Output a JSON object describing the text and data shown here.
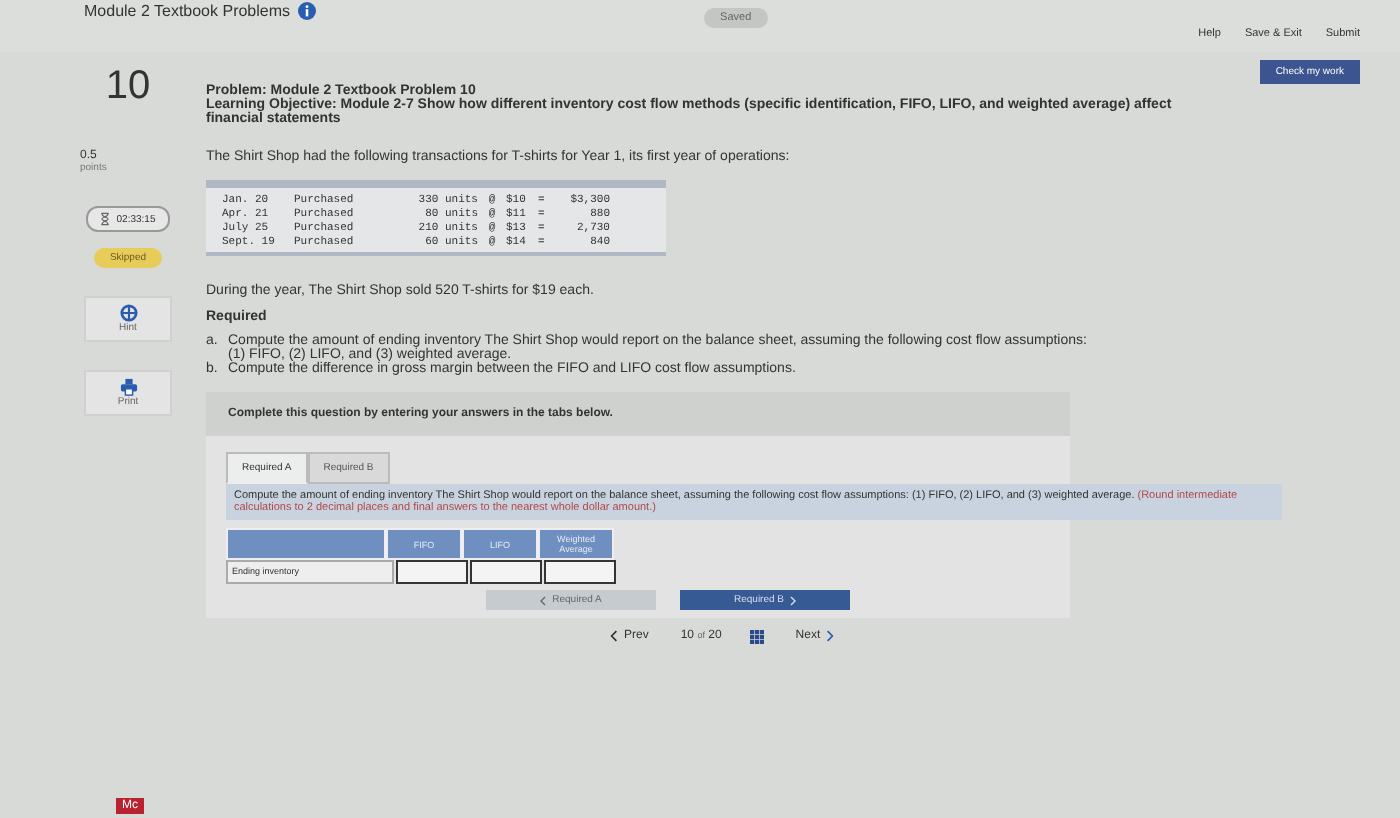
{
  "header": {
    "title": "Module 2 Textbook Problems",
    "saved": "Saved",
    "links": [
      "Help",
      "Save & Exit",
      "Submit"
    ]
  },
  "check_button": "Check my work",
  "question": {
    "number": "10",
    "points": "0.5",
    "points_label": "points",
    "timer": "02:33:15",
    "status": "Skipped"
  },
  "tools": [
    {
      "kind": "hint",
      "label": "Hint"
    },
    {
      "kind": "print",
      "label": "Print"
    }
  ],
  "problem": {
    "title": "Problem: Module 2 Textbook Problem 10",
    "objective": "Learning Objective: Module 2-7 Show how different inventory cost flow methods (specific identification, FIFO, LIFO, and weighted average) affect financial statements",
    "intro": "The Shirt Shop had the following transactions for T-shirts for Year 1, its first year of operations:",
    "transactions": [
      {
        "date": "Jan. 20",
        "type": "Purchased",
        "units": "330 units",
        "at": "@",
        "price": "$10",
        "eq": "=",
        "total": "$3,300"
      },
      {
        "date": "Apr. 21",
        "type": "Purchased",
        "units": "80 units",
        "at": "@",
        "price": "$11",
        "eq": "=",
        "total": "880"
      },
      {
        "date": "July 25",
        "type": "Purchased",
        "units": "210 units",
        "at": "@",
        "price": "$13",
        "eq": "=",
        "total": "2,730"
      },
      {
        "date": "Sept. 19",
        "type": "Purchased",
        "units": "60 units",
        "at": "@",
        "price": "$14",
        "eq": "=",
        "total": "840"
      }
    ],
    "sale": "During the year, The Shirt Shop sold 520 T-shirts for $19 each.",
    "required_heading": "Required",
    "requirements": [
      {
        "marker": "a.",
        "text": "Compute the amount of ending inventory The Shirt Shop would report on the balance sheet, assuming the following cost flow assumptions: (1) FIFO, (2) LIFO, and (3) weighted average."
      },
      {
        "marker": "b.",
        "text": "Compute the difference in gross margin between the FIFO and LIFO cost flow assumptions."
      }
    ]
  },
  "answer_panel": {
    "prompt": "Complete this question by entering your answers in the tabs below.",
    "tabs": [
      {
        "label": "Required A",
        "selected": true
      },
      {
        "label": "Required B",
        "selected": false
      }
    ],
    "instruction": "Compute the amount of ending inventory The Shirt Shop would report on the balance sheet, assuming the following cost flow assumptions: (1) FIFO, (2) LIFO, and (3) weighted average.",
    "note": "(Round intermediate calculations to 2 decimal places and final answers to the nearest whole dollar amount.)",
    "columns": [
      "FIFO",
      "LIFO",
      "Weighted Average"
    ],
    "rows": [
      {
        "label": "Ending inventory"
      }
    ],
    "prev_button": {
      "label": "Required A",
      "disabled": true
    },
    "next_button": {
      "label": "Required B",
      "disabled": false
    }
  },
  "pagination": {
    "prev": "Prev",
    "current": "10",
    "of": "of",
    "total": "20",
    "next": "Next"
  },
  "brand": "Mc"
}
